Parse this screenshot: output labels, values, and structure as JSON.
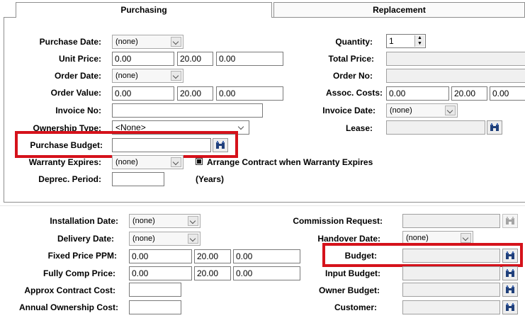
{
  "tabs": [
    {
      "label": "Purchasing",
      "active": true
    },
    {
      "label": "Replacement",
      "active": false
    }
  ],
  "purchasing": {
    "purchase_date": {
      "label": "Purchase Date:",
      "value": "(none)"
    },
    "unit_price": {
      "label": "Unit Price:",
      "values": [
        "0.00",
        "20.00",
        "0.00"
      ]
    },
    "order_date": {
      "label": "Order Date:",
      "value": "(none)"
    },
    "order_value": {
      "label": "Order Value:",
      "values": [
        "0.00",
        "20.00",
        "0.00"
      ]
    },
    "invoice_no": {
      "label": "Invoice No:",
      "value": ""
    },
    "ownership_type": {
      "label": "Ownership Type:",
      "value": "<None>"
    },
    "purchase_budget": {
      "label": "Purchase Budget:",
      "value": ""
    },
    "warranty_expires": {
      "label": "Warranty Expires:",
      "value": "(none)"
    },
    "arrange_contract": {
      "label": "Arrange Contract when Warranty Expires",
      "checked": true
    },
    "deprec_period": {
      "label": "Deprec. Period:",
      "value": "",
      "unit": "(Years)"
    },
    "quantity": {
      "label": "Quantity:",
      "value": "1"
    },
    "total_price": {
      "label": "Total Price:",
      "value": ""
    },
    "order_no": {
      "label": "Order No:",
      "value": ""
    },
    "assoc_costs": {
      "label": "Assoc. Costs:",
      "values": [
        "0.00",
        "20.00",
        "0.00"
      ]
    },
    "invoice_date": {
      "label": "Invoice Date:",
      "value": "(none)"
    },
    "lease": {
      "label": "Lease:",
      "value": ""
    }
  },
  "replacement": {
    "installation_date": {
      "label": "Installation Date:",
      "value": "(none)"
    },
    "delivery_date": {
      "label": "Delivery Date:",
      "value": "(none)"
    },
    "fixed_price_ppm": {
      "label": "Fixed Price PPM:",
      "values": [
        "0.00",
        "20.00",
        "0.00"
      ]
    },
    "fully_comp_price": {
      "label": "Fully Comp Price:",
      "values": [
        "0.00",
        "20.00",
        "0.00"
      ]
    },
    "approx_contract_cost": {
      "label": "Approx Contract Cost:",
      "value": ""
    },
    "annual_ownership_cost": {
      "label": "Annual Ownership Cost:",
      "value": ""
    },
    "commission_request": {
      "label": "Commission Request:",
      "value": ""
    },
    "handover_date": {
      "label": "Handover Date:",
      "value": "(none)"
    },
    "budget": {
      "label": "Budget:",
      "value": ""
    },
    "input_budget": {
      "label": "Input Budget:",
      "value": ""
    },
    "owner_budget": {
      "label": "Owner Budget:",
      "value": ""
    },
    "customer": {
      "label": "Customer:",
      "value": ""
    }
  },
  "colors": {
    "highlight": "#d5121b",
    "panel_border": "#8f8f8f"
  },
  "icons": {
    "lookup": "binoculars-icon",
    "dropdown": "chevron-down-icon",
    "spin": "spin-arrows-icon"
  }
}
